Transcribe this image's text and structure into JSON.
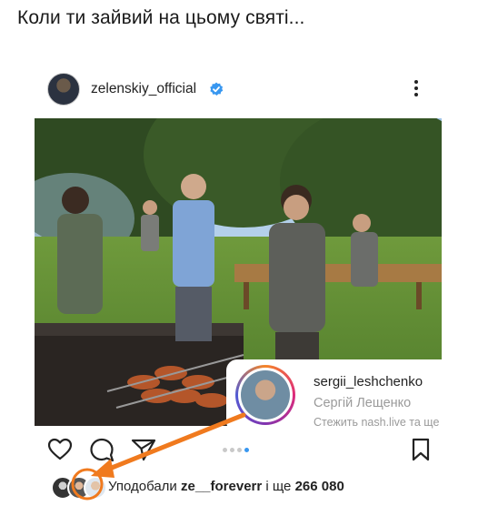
{
  "caption": "Коли ти зайвий на цьому святі...",
  "post": {
    "username": "zelenskiy_official",
    "verified": true,
    "avatar_icon": "profile-avatar",
    "menu_icon": "more-options-icon"
  },
  "profile_card": {
    "handle": "sergii_leshchenko",
    "name": "Сергій Лещенко",
    "follow_text": "Стежить nash.live та ще"
  },
  "actions": {
    "icons": [
      "heart-icon",
      "comment-icon",
      "share-icon",
      "bookmark-icon"
    ],
    "carousel_total": 4,
    "carousel_active": 4
  },
  "likes": {
    "prefix": "Уподобали ",
    "user": "ze__foreverr",
    "middle": " і ще ",
    "count": "266 080"
  },
  "colors": {
    "accent_blue": "#3897f0",
    "arrow_orange": "#f07a1e",
    "verified_blue": "#3897f0"
  }
}
